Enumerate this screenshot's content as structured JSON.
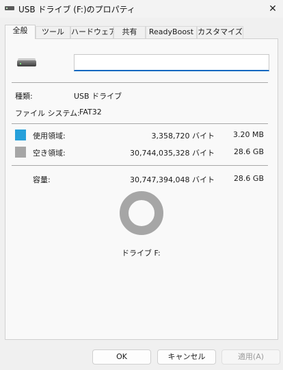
{
  "window": {
    "title": "USB ドライブ (F:)のプロパティ",
    "close_glyph": "✕"
  },
  "tabs": [
    {
      "label": "全般",
      "active": true
    },
    {
      "label": "ツール",
      "active": false
    },
    {
      "label": "ハードウェア",
      "active": false
    },
    {
      "label": "共有",
      "active": false
    },
    {
      "label": "ReadyBoost",
      "active": false
    },
    {
      "label": "カスタマイズ",
      "active": false
    }
  ],
  "general": {
    "drive_icon": "usb-drive-icon",
    "name_value": "",
    "type_label": "種類:",
    "type_value": "USB ドライブ",
    "fs_label": "ファイル システム:",
    "fs_value": "FAT32"
  },
  "space": {
    "used": {
      "label": "使用領域:",
      "bytes": "3,358,720 バイト",
      "size": "3.20 MB",
      "color": "#26a0da"
    },
    "free": {
      "label": "空き領域:",
      "bytes": "30,744,035,328 バイト",
      "size": "28.6 GB",
      "color": "#a6a6a6"
    },
    "capacity": {
      "label": "容量:",
      "bytes": "30,747,394,048 バイト",
      "size": "28.6 GB"
    },
    "used_fraction": 0.000109
  },
  "drive_caption": "ドライブ F:",
  "buttons": {
    "ok": "OK",
    "cancel": "キャンセル",
    "apply": "適用(A)"
  }
}
